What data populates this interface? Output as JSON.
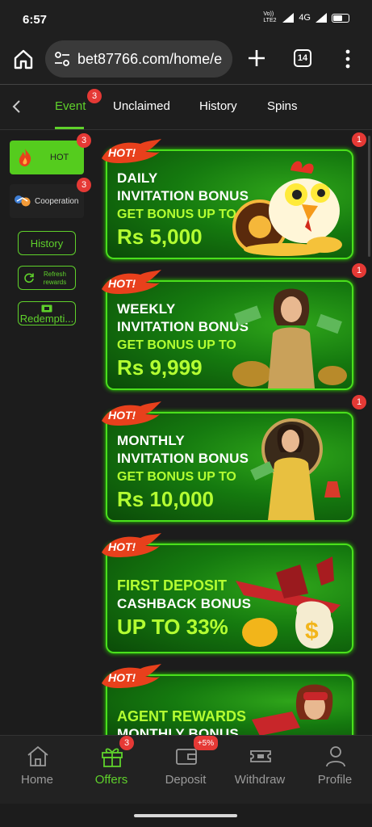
{
  "status_bar": {
    "time": "6:57",
    "carrier": "Vo)) LTE2",
    "network": "4G"
  },
  "browser": {
    "url": "bet87766.com/home/e",
    "tab_count": "14"
  },
  "tabs": [
    {
      "label": "Event",
      "badge": "3",
      "active": true
    },
    {
      "label": "Unclaimed",
      "active": false
    },
    {
      "label": "History",
      "active": false
    },
    {
      "label": "Spins",
      "active": false
    }
  ],
  "sidebar": {
    "hot": {
      "label": "HOT",
      "badge": "3"
    },
    "cooperation": {
      "label": "Cooperation",
      "badge": "3"
    },
    "history": "History",
    "refresh": "Refresh rewards",
    "redemption": "Redempti..."
  },
  "cards": [
    {
      "hot": "HOT!",
      "line1": "DAILY",
      "line2": "INVITATION BONUS",
      "line3": "GET BONUS UP TO",
      "line4": "Rs 5,000",
      "badge": "1",
      "art_icon": "chicken-roulette-icon"
    },
    {
      "hot": "HOT!",
      "line1": "WEEKLY",
      "line2": "INVITATION BONUS",
      "line3": "GET BONUS UP TO",
      "line4": "Rs 9,999",
      "badge": "1",
      "art_icon": "woman-money-icon"
    },
    {
      "hot": "HOT!",
      "line1": "MONTHLY",
      "line2": "INVITATION BONUS",
      "line3": "GET BONUS UP TO",
      "line4": "Rs 10,000",
      "badge": "1",
      "art_icon": "woman-roulette-icon"
    },
    {
      "hot": "HOT!",
      "line1": "FIRST DEPOSIT",
      "line2": "CASHBACK BONUS",
      "line3": "",
      "line4": "UP TO 33%",
      "badge": "",
      "art_icon": "airplane-money-icon"
    },
    {
      "hot": "HOT!",
      "line1": "AGENT REWARDS",
      "line2": "MONTHLY BONUS",
      "line3": "",
      "line4": "",
      "badge": "",
      "art_icon": "aviator-woman-icon"
    }
  ],
  "bottom_nav": [
    {
      "label": "Home",
      "icon": "home-icon",
      "active": false
    },
    {
      "label": "Offers",
      "icon": "gift-icon",
      "active": true,
      "badge": "3"
    },
    {
      "label": "Deposit",
      "icon": "wallet-icon",
      "active": false,
      "badge": "+5%"
    },
    {
      "label": "Withdraw",
      "icon": "ticket-icon",
      "active": false
    },
    {
      "label": "Profile",
      "icon": "profile-icon",
      "active": false
    }
  ],
  "colors": {
    "accent": "#5fd12b",
    "badge": "#e53935",
    "card_border": "#4ae01c",
    "card_highlight": "#b4ff32"
  }
}
